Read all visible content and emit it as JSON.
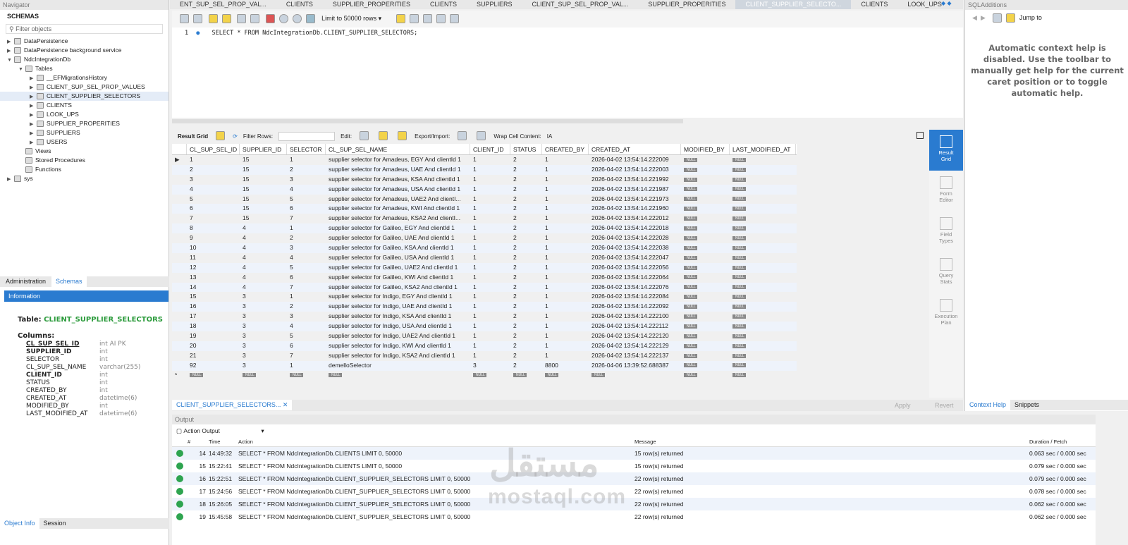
{
  "navigator": {
    "title": "Navigator",
    "schemas_label": "SCHEMAS",
    "filter_placeholder": "Filter objects",
    "tree": [
      {
        "label": "DataPersistence",
        "level": 0,
        "tw": "▶"
      },
      {
        "label": "DataPersistence background service",
        "level": 0,
        "tw": "▶"
      },
      {
        "label": "NdcIntegrationDb",
        "level": 0,
        "tw": "▼"
      },
      {
        "label": "Tables",
        "level": 1,
        "tw": "▼"
      },
      {
        "label": "__EFMigrationsHistory",
        "level": 2,
        "tw": "▶"
      },
      {
        "label": "CLIENT_SUP_SEL_PROP_VALUES",
        "level": 2,
        "tw": "▶"
      },
      {
        "label": "CLIENT_SUPPLIER_SELECTORS",
        "level": 2,
        "tw": "▶",
        "selected": true
      },
      {
        "label": "CLIENTS",
        "level": 2,
        "tw": "▶"
      },
      {
        "label": "LOOK_UPS",
        "level": 2,
        "tw": "▶"
      },
      {
        "label": "SUPPLIER_PROPERITIES",
        "level": 2,
        "tw": "▶"
      },
      {
        "label": "SUPPLIERS",
        "level": 2,
        "tw": "▶"
      },
      {
        "label": "USERS",
        "level": 2,
        "tw": "▶"
      },
      {
        "label": "Views",
        "level": 1,
        "tw": ""
      },
      {
        "label": "Stored Procedures",
        "level": 1,
        "tw": ""
      },
      {
        "label": "Functions",
        "level": 1,
        "tw": ""
      },
      {
        "label": "sys",
        "level": 0,
        "tw": "▶"
      }
    ],
    "bottom_tabs": [
      "Administration",
      "Schemas"
    ],
    "info_title": "Information",
    "table_label": "Table:",
    "table_name": "CLIENT_SUPPLIER_SELECTORS",
    "columns_label": "Columns:",
    "columns": [
      [
        "CL_SUP_SEL_ID",
        "int AI PK"
      ],
      [
        "SUPPLIER_ID",
        "int"
      ],
      [
        "SELECTOR",
        "int"
      ],
      [
        "CL_SUP_SEL_NAME",
        "varchar(255)"
      ],
      [
        "CLIENT_ID",
        "int"
      ],
      [
        "STATUS",
        "int"
      ],
      [
        "CREATED_BY",
        "int"
      ],
      [
        "CREATED_AT",
        "datetime(6)"
      ],
      [
        "MODIFIED_BY",
        "int"
      ],
      [
        "LAST_MODIFIED_AT",
        "datetime(6)"
      ]
    ],
    "footer_tabs": [
      "Object Info",
      "Session"
    ]
  },
  "tabs": [
    "ENT_SUP_SEL_PROP_VAL...",
    "CLIENTS",
    "SUPPLIER_PROPERITIES",
    "CLIENTS",
    "SUPPLIERS",
    "CLIENT_SUP_SEL_PROP_VAL...",
    "SUPPLIER_PROPERITIES",
    "CLIENT_SUPPLIER_SELECTO...",
    "CLIENTS",
    "LOOK_UPS"
  ],
  "active_tab": 7,
  "toolbar": {
    "limit": "Limit to 50000 rows"
  },
  "editor": {
    "line": "1",
    "sql": "SELECT * FROM NdcIntegrationDb.CLIENT_SUPPLIER_SELECTORS;"
  },
  "result_toolbar": {
    "result_grid": "Result Grid",
    "filter_rows": "Filter Rows:",
    "edit": "Edit:",
    "export": "Export/Import:",
    "wrap": "Wrap Cell Content:"
  },
  "grid": {
    "columns": [
      "CL_SUP_SEL_ID",
      "SUPPLIER_ID",
      "SELECTOR",
      "CL_SUP_SEL_NAME",
      "CLIENT_ID",
      "STATUS",
      "CREATED_BY",
      "CREATED_AT",
      "MODIFIED_BY",
      "LAST_MODIFIED_AT"
    ],
    "null_label": "NULL",
    "rows": [
      [
        "1",
        "15",
        "1",
        "supplier selector for Amadeus, EGY And clientId 1",
        "1",
        "2",
        "1",
        "2026-04-02 13:54:14.222009"
      ],
      [
        "2",
        "15",
        "2",
        "supplier selector for Amadeus, UAE And clientId 1",
        "1",
        "2",
        "1",
        "2026-04-02 13:54:14.222003"
      ],
      [
        "3",
        "15",
        "3",
        "supplier selector for Amadeus, KSA And clientId 1",
        "1",
        "2",
        "1",
        "2026-04-02 13:54:14.221992"
      ],
      [
        "4",
        "15",
        "4",
        "supplier selector for Amadeus, USA And clientId 1",
        "1",
        "2",
        "1",
        "2026-04-02 13:54:14.221987"
      ],
      [
        "5",
        "15",
        "5",
        "supplier selector for Amadeus, UAE2 And clientI...",
        "1",
        "2",
        "1",
        "2026-04-02 13:54:14.221973"
      ],
      [
        "6",
        "15",
        "6",
        "supplier selector for Amadeus, KWI And clientId 1",
        "1",
        "2",
        "1",
        "2026-04-02 13:54:14.221960"
      ],
      [
        "7",
        "15",
        "7",
        "supplier selector for Amadeus, KSA2 And clientI...",
        "1",
        "2",
        "1",
        "2026-04-02 13:54:14.222012"
      ],
      [
        "8",
        "4",
        "1",
        "supplier selector for Galileo, EGY And clientId 1",
        "1",
        "2",
        "1",
        "2026-04-02 13:54:14.222018"
      ],
      [
        "9",
        "4",
        "2",
        "supplier selector for Galileo, UAE And clientId 1",
        "1",
        "2",
        "1",
        "2026-04-02 13:54:14.222028"
      ],
      [
        "10",
        "4",
        "3",
        "supplier selector for Galileo, KSA And clientId 1",
        "1",
        "2",
        "1",
        "2026-04-02 13:54:14.222038"
      ],
      [
        "11",
        "4",
        "4",
        "supplier selector for Galileo, USA And clientId 1",
        "1",
        "2",
        "1",
        "2026-04-02 13:54:14.222047"
      ],
      [
        "12",
        "4",
        "5",
        "supplier selector for Galileo, UAE2 And clientId 1",
        "1",
        "2",
        "1",
        "2026-04-02 13:54:14.222056"
      ],
      [
        "13",
        "4",
        "6",
        "supplier selector for Galileo, KWI And clientId 1",
        "1",
        "2",
        "1",
        "2026-04-02 13:54:14.222064"
      ],
      [
        "14",
        "4",
        "7",
        "supplier selector for Galileo, KSA2 And clientId 1",
        "1",
        "2",
        "1",
        "2026-04-02 13:54:14.222076"
      ],
      [
        "15",
        "3",
        "1",
        "supplier selector for Indigo, EGY And clientId 1",
        "1",
        "2",
        "1",
        "2026-04-02 13:54:14.222084"
      ],
      [
        "16",
        "3",
        "2",
        "supplier selector for Indigo, UAE And clientId 1",
        "1",
        "2",
        "1",
        "2026-04-02 13:54:14.222092"
      ],
      [
        "17",
        "3",
        "3",
        "supplier selector for Indigo, KSA And clientId 1",
        "1",
        "2",
        "1",
        "2026-04-02 13:54:14.222100"
      ],
      [
        "18",
        "3",
        "4",
        "supplier selector for Indigo, USA And clientId 1",
        "1",
        "2",
        "1",
        "2026-04-02 13:54:14.222112"
      ],
      [
        "19",
        "3",
        "5",
        "supplier selector for Indigo, UAE2 And clientId 1",
        "1",
        "2",
        "1",
        "2026-04-02 13:54:14.222120"
      ],
      [
        "20",
        "3",
        "6",
        "supplier selector for Indigo, KWI And clientId 1",
        "1",
        "2",
        "1",
        "2026-04-02 13:54:14.222129"
      ],
      [
        "21",
        "3",
        "7",
        "supplier selector for Indigo, KSA2 And clientId 1",
        "1",
        "2",
        "1",
        "2026-04-02 13:54:14.222137"
      ],
      [
        "92",
        "3",
        "1",
        "demelloSelector",
        "3",
        "2",
        "8800",
        "2026-04-06 13:39:52.688387"
      ]
    ]
  },
  "side_buttons": [
    "Result Grid",
    "Form Editor",
    "Field Types",
    "Query Stats",
    "Execution Plan"
  ],
  "result_tab": "CLIENT_SUPPLIER_SELECTORS...",
  "apply": "Apply",
  "revert": "Revert",
  "output": {
    "title": "Output",
    "selector": "Action Output",
    "headers": [
      "#",
      "Time",
      "Action",
      "Message",
      "Duration / Fetch"
    ],
    "rows": [
      [
        "14",
        "14:49:32",
        "SELECT * FROM NdcIntegrationDb.CLIENTS LIMIT 0, 50000",
        "15 row(s) returned",
        "0.063 sec / 0.000 sec"
      ],
      [
        "15",
        "15:22:41",
        "SELECT * FROM NdcIntegrationDb.CLIENTS LIMIT 0, 50000",
        "15 row(s) returned",
        "0.079 sec / 0.000 sec"
      ],
      [
        "16",
        "15:22:51",
        "SELECT * FROM NdcIntegrationDb.CLIENT_SUPPLIER_SELECTORS LIMIT 0, 50000",
        "22 row(s) returned",
        "0.079 sec / 0.000 sec"
      ],
      [
        "17",
        "15:24:56",
        "SELECT * FROM NdcIntegrationDb.CLIENT_SUPPLIER_SELECTORS LIMIT 0, 50000",
        "22 row(s) returned",
        "0.078 sec / 0.000 sec"
      ],
      [
        "18",
        "15:26:05",
        "SELECT * FROM NdcIntegrationDb.CLIENT_SUPPLIER_SELECTORS LIMIT 0, 50000",
        "22 row(s) returned",
        "0.062 sec / 0.000 sec"
      ],
      [
        "19",
        "15:45:58",
        "SELECT * FROM NdcIntegrationDb.CLIENT_SUPPLIER_SELECTORS LIMIT 0, 50000",
        "22 row(s) returned",
        "0.062 sec / 0.000 sec"
      ]
    ]
  },
  "sql_additions": {
    "title": "SQLAdditions",
    "jump_to": "Jump to",
    "help": "Automatic context help is disabled. Use the toolbar to manually get help for the current caret position or to toggle automatic help.",
    "tabs": [
      "Context Help",
      "Snippets"
    ]
  },
  "watermark": {
    "arabic": "مستقل",
    "latin": "mostaql.com"
  }
}
